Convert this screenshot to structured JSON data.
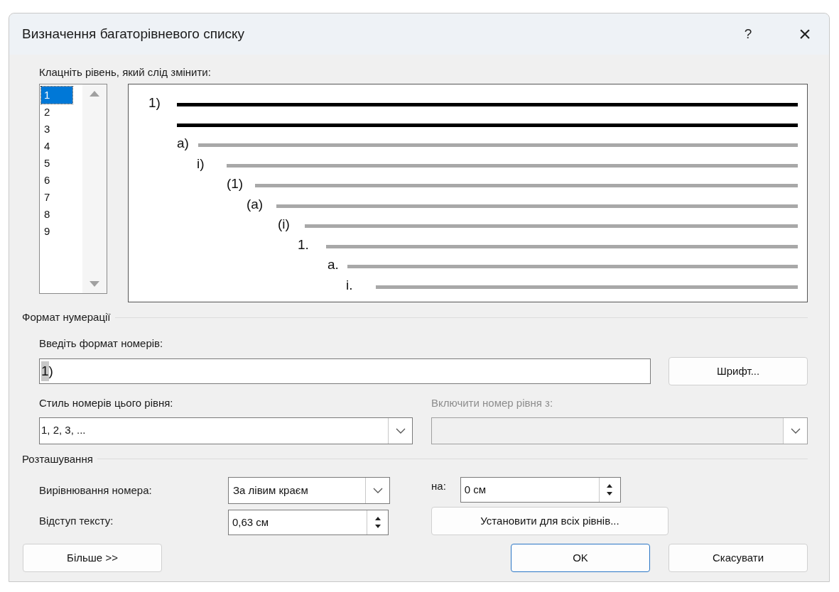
{
  "window": {
    "title": "Визначення багаторівневого списку",
    "help": "?",
    "close": "×"
  },
  "level_list": {
    "label": "Клацніть рівень, який слід змінити:",
    "items": [
      {
        "label": "1",
        "selected": true
      },
      {
        "label": "2",
        "selected": false
      },
      {
        "label": "3",
        "selected": false
      },
      {
        "label": "4",
        "selected": false
      },
      {
        "label": "5",
        "selected": false
      },
      {
        "label": "6",
        "selected": false
      },
      {
        "label": "7",
        "selected": false
      },
      {
        "label": "8",
        "selected": false
      },
      {
        "label": "9",
        "selected": false
      }
    ]
  },
  "preview": {
    "levels": [
      {
        "label": "1)",
        "selected": true
      },
      {
        "label": "a)",
        "selected": false
      },
      {
        "label": "i)",
        "selected": false
      },
      {
        "label": "(1)",
        "selected": false
      },
      {
        "label": "(a)",
        "selected": false
      },
      {
        "label": "(i)",
        "selected": false
      },
      {
        "label": "1.",
        "selected": false
      },
      {
        "label": "a.",
        "selected": false
      },
      {
        "label": "i.",
        "selected": false
      }
    ]
  },
  "number_format": {
    "heading": "Формат нумерації",
    "format_label": "Введіть формат номерів:",
    "format_number": "1",
    "format_suffix": ")",
    "font_button": "Шрифт...",
    "style_label": "Стиль номерів цього рівня:",
    "style_value": "1, 2, 3, ...",
    "include_label": "Включити номер рівня з:",
    "include_disabled": true
  },
  "position": {
    "heading": "Розташування",
    "align_label": "Вирівнювання номера:",
    "align_value": "За лівим краєм",
    "at_label": "на:",
    "at_value": "0 см",
    "indent_label": "Відступ тексту:",
    "indent_value": "0,63 см",
    "set_all_button": "Установити для всіх рівнів..."
  },
  "buttons": [
    {
      "label": "Більше >>",
      "kind": "secondary"
    },
    {
      "label": "OK",
      "kind": "default"
    },
    {
      "label": "Скасувати",
      "kind": "secondary"
    }
  ]
}
